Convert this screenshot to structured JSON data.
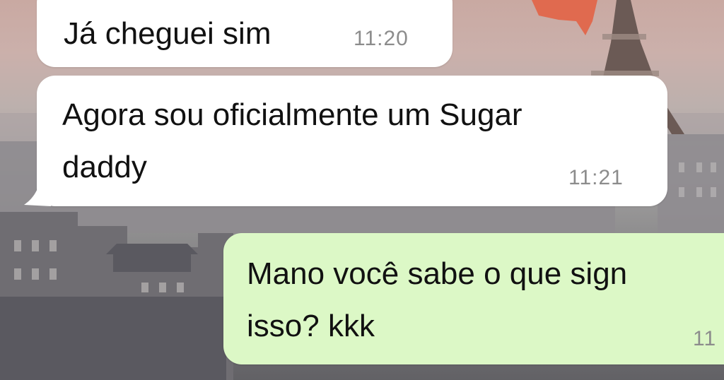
{
  "chat": {
    "messages": [
      {
        "direction": "incoming",
        "text": "Já cheguei sim",
        "time": "11:20"
      },
      {
        "direction": "incoming",
        "lines": [
          "Agora sou oficialmente um Sugar",
          "daddy"
        ],
        "time": "11:21"
      },
      {
        "direction": "outgoing",
        "lines": [
          "Mano você sabe o que sign",
          "isso? kkk"
        ],
        "time": "11"
      }
    ]
  },
  "colors": {
    "incoming_bubble": "#ffffff",
    "outgoing_bubble": "#dcf8c6",
    "message_text": "#111111",
    "timestamp": "#8c8c8c",
    "wallpaper_sky": "#c9a9a2"
  },
  "wallpaper": {
    "icon": "paris-eiffel-tower-wallpaper"
  }
}
